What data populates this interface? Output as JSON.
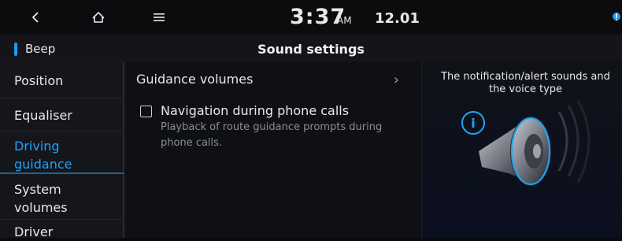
{
  "topbar": {
    "back_icon": "back-arrow-icon",
    "home_icon": "home-icon",
    "menu_icon": "menu-icon",
    "time": "3:37",
    "ampm": "AM",
    "date": "12.01",
    "status_icon": "bluetooth-voice-icon"
  },
  "subheader": {
    "tab_label": "Beep",
    "title": "Sound settings"
  },
  "sidebar": {
    "items": [
      {
        "label": "Position"
      },
      {
        "label": "Equaliser"
      },
      {
        "label": "Driving guidance",
        "selected": true
      },
      {
        "label": "System volumes"
      },
      {
        "label": "Driver"
      }
    ]
  },
  "main": {
    "guidance_label": "Guidance volumes",
    "nav_calls_label": "Navigation during phone calls",
    "nav_calls_desc": "Playback of route guidance prompts during phone calls.",
    "nav_calls_checked": false
  },
  "info": {
    "text": "The notification/alert sounds and the voice type",
    "icon": "info-icon",
    "illustration": "speaker-icon"
  },
  "colors": {
    "accent": "#1c9bf0",
    "background": "#0b0c10"
  }
}
